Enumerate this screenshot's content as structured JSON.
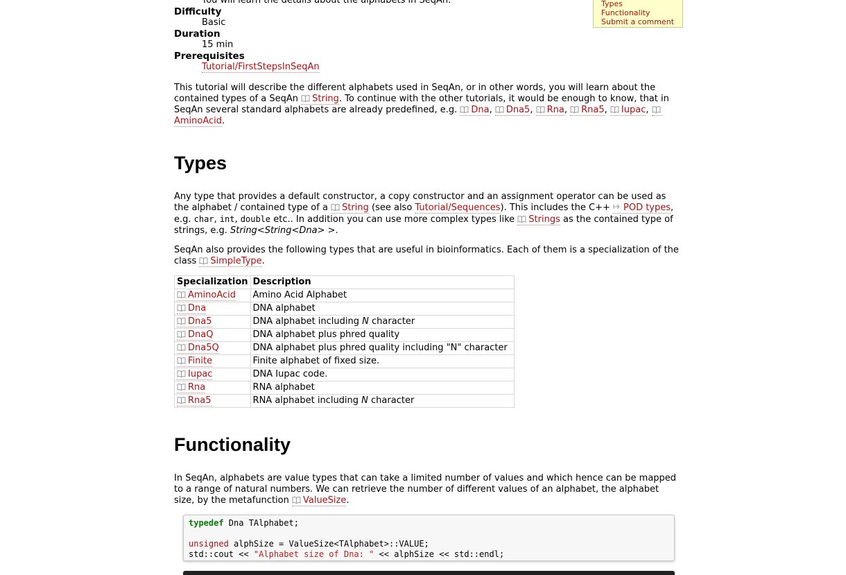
{
  "intro_cut_line": "You will learn the details about the alphabets in SeqAn.",
  "toc": {
    "items": [
      "Types",
      "Functionality",
      "Submit a comment"
    ]
  },
  "meta": {
    "difficulty_label": "Difficulty",
    "difficulty_value": "Basic",
    "duration_label": "Duration",
    "duration_value": "15 min",
    "prerequisites_label": "Prerequisites",
    "prerequisites_link": "Tutorial/FirstStepsInSeqAn"
  },
  "intro": {
    "t1": "This tutorial will describe the different alphabets used in SeqAn, or in other words, you will learn about the contained types of a SeqAn ",
    "l_string": "String",
    "t2": ". To continue with the other tutorials, it would be enough to know, that in SeqAn several standard alphabets are already predefined, e.g. ",
    "l_dna": "Dna",
    "l_dna5": "Dna5",
    "l_rna": "Rna",
    "l_rna5": "Rna5",
    "l_iupac": "Iupac",
    "l_aminoacid": "AminoAcid",
    "sep": ", ",
    "end": "."
  },
  "types": {
    "heading": "Types",
    "p1_t1": "Any type that provides a default constructor, a copy constructor and an assignment operator can be used as the alphabet / contained type of a ",
    "p1_string": "String",
    "p1_t2": " (see also ",
    "p1_seq_link": "Tutorial/Sequences",
    "p1_t3": "). This includes the C++ ",
    "p1_pod": "POD types",
    "p1_t4": ", e.g. ",
    "p1_char": "char",
    "p1_int": "int",
    "p1_double": "double",
    "p1_t5": " etc.. In addition you can use more complex types like ",
    "p1_strings": "Strings",
    "p1_t6": " as the contained type of strings, e.g. ",
    "p1_example": "String<String<Dna> >",
    "p1_t7": ".",
    "p2_t1": "SeqAn also provides the following types that are useful in bioinformatics. Each of them is a specialization of the class ",
    "p2_simpletype": "SimpleType",
    "p2_t2": "."
  },
  "table": {
    "headers": [
      "Specialization",
      "Description"
    ],
    "rows": [
      {
        "spec": "AminoAcid",
        "desc": "Amino Acid Alphabet"
      },
      {
        "spec": "Dna",
        "desc": "DNA alphabet"
      },
      {
        "spec": "Dna5",
        "desc_pre": "DNA alphabet including ",
        "desc_em": "N",
        "desc_post": " character"
      },
      {
        "spec": "DnaQ",
        "desc": "DNA alphabet plus phred quality"
      },
      {
        "spec": "Dna5Q",
        "desc": "DNA alphabet plus phred quality including \"N\" character"
      },
      {
        "spec": "Finite",
        "desc": "Finite alphabet of fixed size."
      },
      {
        "spec": "Iupac",
        "desc": "DNA Iupac code."
      },
      {
        "spec": "Rna",
        "desc": "RNA alphabet"
      },
      {
        "spec": "Rna5",
        "desc_pre": "RNA alphabet including ",
        "desc_em": "N",
        "desc_post": " character"
      }
    ]
  },
  "functionality": {
    "heading": "Functionality",
    "p_t1": "In SeqAn, alphabets are value types that can take a limited number of values and which hence can be mapped to a range of natural numbers. We can retrieve the number of different values of an alphabet, the alphabet size, by the metafunction ",
    "p_valuesize": "ValueSize",
    "p_t2": "."
  },
  "code": {
    "l1_kw": "typedef",
    "l1_rest": " Dna TAlphabet;",
    "l3_kw": "unsigned",
    "l3_rest": " alphSize = ValueSize<TAlphabet>::VALUE;",
    "l4_a": "std::cout << ",
    "l4_str": "\"Alphabet size of Dna: \"",
    "l4_b": " << alphSize << std::endl;"
  }
}
